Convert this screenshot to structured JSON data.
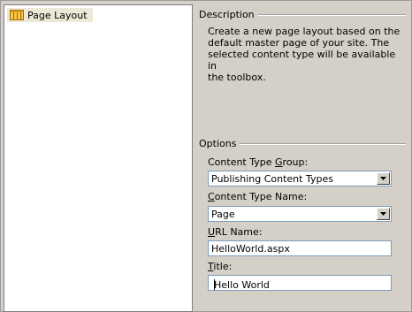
{
  "list": {
    "items": [
      {
        "label": "Page Layout",
        "icon": "page-layout-icon"
      }
    ]
  },
  "description": {
    "heading": "Description",
    "lines": [
      "Create a new page layout based on the",
      "default master page of your site. The",
      "selected content type will be available in",
      "the toolbox."
    ]
  },
  "options": {
    "heading": "Options",
    "content_type_group": {
      "label_mnemonic": "G",
      "label_before": "Content Type ",
      "label_after": "roup:",
      "value": "Publishing Content Types"
    },
    "content_type_name": {
      "label_mnemonic": "C",
      "label_rest": "ontent Type Name:",
      "value": "Page"
    },
    "url_name": {
      "label_mnemonic": "U",
      "label_rest": "RL Name:",
      "value": "HelloWorld.aspx"
    },
    "title": {
      "label_mnemonic": "T",
      "label_rest": "itle:",
      "value": "Hello World"
    }
  }
}
